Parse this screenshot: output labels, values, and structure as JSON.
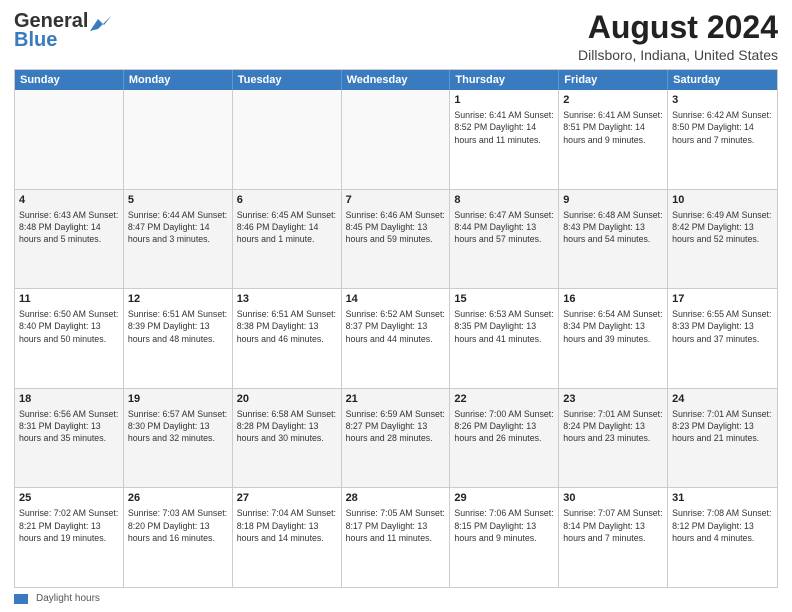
{
  "logo": {
    "line1": "General",
    "line2": "Blue"
  },
  "title": "August 2024",
  "location": "Dillsboro, Indiana, United States",
  "header_days": [
    "Sunday",
    "Monday",
    "Tuesday",
    "Wednesday",
    "Thursday",
    "Friday",
    "Saturday"
  ],
  "weeks": [
    [
      {
        "day": "",
        "info": ""
      },
      {
        "day": "",
        "info": ""
      },
      {
        "day": "",
        "info": ""
      },
      {
        "day": "",
        "info": ""
      },
      {
        "day": "1",
        "info": "Sunrise: 6:41 AM\nSunset: 8:52 PM\nDaylight: 14 hours and 11 minutes."
      },
      {
        "day": "2",
        "info": "Sunrise: 6:41 AM\nSunset: 8:51 PM\nDaylight: 14 hours and 9 minutes."
      },
      {
        "day": "3",
        "info": "Sunrise: 6:42 AM\nSunset: 8:50 PM\nDaylight: 14 hours and 7 minutes."
      }
    ],
    [
      {
        "day": "4",
        "info": "Sunrise: 6:43 AM\nSunset: 8:48 PM\nDaylight: 14 hours and 5 minutes."
      },
      {
        "day": "5",
        "info": "Sunrise: 6:44 AM\nSunset: 8:47 PM\nDaylight: 14 hours and 3 minutes."
      },
      {
        "day": "6",
        "info": "Sunrise: 6:45 AM\nSunset: 8:46 PM\nDaylight: 14 hours and 1 minute."
      },
      {
        "day": "7",
        "info": "Sunrise: 6:46 AM\nSunset: 8:45 PM\nDaylight: 13 hours and 59 minutes."
      },
      {
        "day": "8",
        "info": "Sunrise: 6:47 AM\nSunset: 8:44 PM\nDaylight: 13 hours and 57 minutes."
      },
      {
        "day": "9",
        "info": "Sunrise: 6:48 AM\nSunset: 8:43 PM\nDaylight: 13 hours and 54 minutes."
      },
      {
        "day": "10",
        "info": "Sunrise: 6:49 AM\nSunset: 8:42 PM\nDaylight: 13 hours and 52 minutes."
      }
    ],
    [
      {
        "day": "11",
        "info": "Sunrise: 6:50 AM\nSunset: 8:40 PM\nDaylight: 13 hours and 50 minutes."
      },
      {
        "day": "12",
        "info": "Sunrise: 6:51 AM\nSunset: 8:39 PM\nDaylight: 13 hours and 48 minutes."
      },
      {
        "day": "13",
        "info": "Sunrise: 6:51 AM\nSunset: 8:38 PM\nDaylight: 13 hours and 46 minutes."
      },
      {
        "day": "14",
        "info": "Sunrise: 6:52 AM\nSunset: 8:37 PM\nDaylight: 13 hours and 44 minutes."
      },
      {
        "day": "15",
        "info": "Sunrise: 6:53 AM\nSunset: 8:35 PM\nDaylight: 13 hours and 41 minutes."
      },
      {
        "day": "16",
        "info": "Sunrise: 6:54 AM\nSunset: 8:34 PM\nDaylight: 13 hours and 39 minutes."
      },
      {
        "day": "17",
        "info": "Sunrise: 6:55 AM\nSunset: 8:33 PM\nDaylight: 13 hours and 37 minutes."
      }
    ],
    [
      {
        "day": "18",
        "info": "Sunrise: 6:56 AM\nSunset: 8:31 PM\nDaylight: 13 hours and 35 minutes."
      },
      {
        "day": "19",
        "info": "Sunrise: 6:57 AM\nSunset: 8:30 PM\nDaylight: 13 hours and 32 minutes."
      },
      {
        "day": "20",
        "info": "Sunrise: 6:58 AM\nSunset: 8:28 PM\nDaylight: 13 hours and 30 minutes."
      },
      {
        "day": "21",
        "info": "Sunrise: 6:59 AM\nSunset: 8:27 PM\nDaylight: 13 hours and 28 minutes."
      },
      {
        "day": "22",
        "info": "Sunrise: 7:00 AM\nSunset: 8:26 PM\nDaylight: 13 hours and 26 minutes."
      },
      {
        "day": "23",
        "info": "Sunrise: 7:01 AM\nSunset: 8:24 PM\nDaylight: 13 hours and 23 minutes."
      },
      {
        "day": "24",
        "info": "Sunrise: 7:01 AM\nSunset: 8:23 PM\nDaylight: 13 hours and 21 minutes."
      }
    ],
    [
      {
        "day": "25",
        "info": "Sunrise: 7:02 AM\nSunset: 8:21 PM\nDaylight: 13 hours and 19 minutes."
      },
      {
        "day": "26",
        "info": "Sunrise: 7:03 AM\nSunset: 8:20 PM\nDaylight: 13 hours and 16 minutes."
      },
      {
        "day": "27",
        "info": "Sunrise: 7:04 AM\nSunset: 8:18 PM\nDaylight: 13 hours and 14 minutes."
      },
      {
        "day": "28",
        "info": "Sunrise: 7:05 AM\nSunset: 8:17 PM\nDaylight: 13 hours and 11 minutes."
      },
      {
        "day": "29",
        "info": "Sunrise: 7:06 AM\nSunset: 8:15 PM\nDaylight: 13 hours and 9 minutes."
      },
      {
        "day": "30",
        "info": "Sunrise: 7:07 AM\nSunset: 8:14 PM\nDaylight: 13 hours and 7 minutes."
      },
      {
        "day": "31",
        "info": "Sunrise: 7:08 AM\nSunset: 8:12 PM\nDaylight: 13 hours and 4 minutes."
      }
    ]
  ],
  "footer": {
    "legend_label": "Daylight hours"
  }
}
